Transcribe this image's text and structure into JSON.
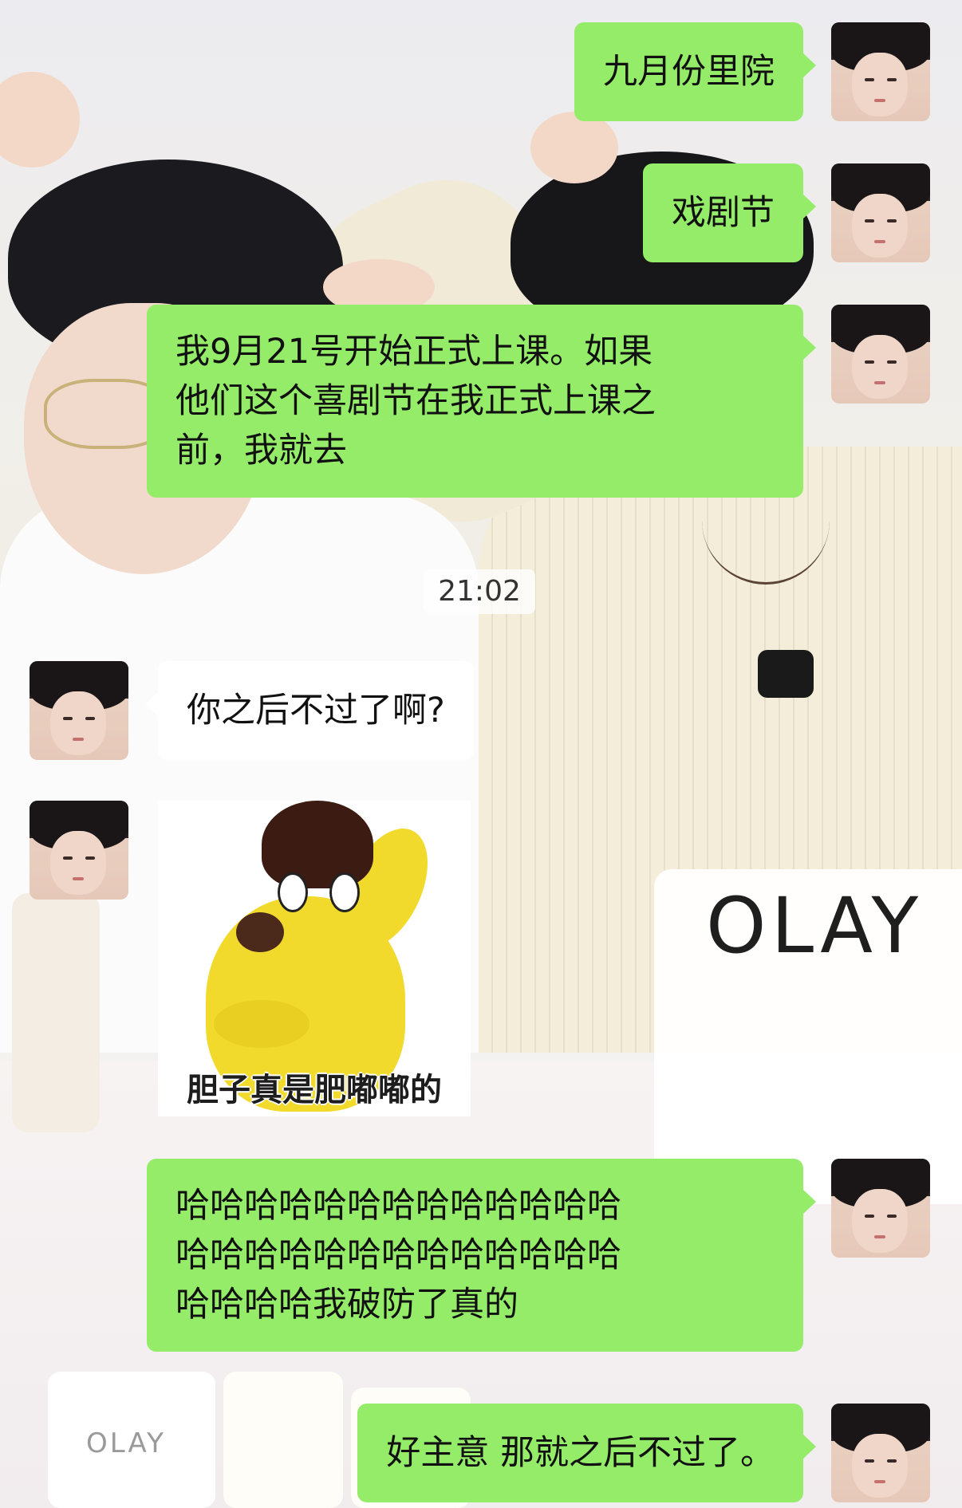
{
  "background": {
    "brand_sign": "OLAY",
    "brand_bottle": "OLAY"
  },
  "messages": [
    {
      "side": "out",
      "type": "text",
      "text": "九月份里院"
    },
    {
      "side": "out",
      "type": "text",
      "text": "戏剧节"
    },
    {
      "side": "out",
      "type": "text",
      "text": "我9月21号开始正式上课。如果\n他们这个喜剧节在我正式上课之\n前，我就去"
    },
    {
      "side": "system",
      "type": "time",
      "text": "21:02"
    },
    {
      "side": "in",
      "type": "text",
      "text": "你之后不过了啊?"
    },
    {
      "side": "in",
      "type": "sticker",
      "caption": "胆子真是肥嘟嘟的",
      "icon": "yellow-dog-sticker"
    },
    {
      "side": "out",
      "type": "text",
      "text": "哈哈哈哈哈哈哈哈哈哈哈哈哈\n哈哈哈哈哈哈哈哈哈哈哈哈哈\n哈哈哈哈我破防了真的"
    },
    {
      "side": "out",
      "type": "text",
      "text": "好主意 那就之后不过了。"
    }
  ],
  "colors": {
    "outgoing_bubble": "#95ec69",
    "incoming_bubble": "#ffffff"
  }
}
